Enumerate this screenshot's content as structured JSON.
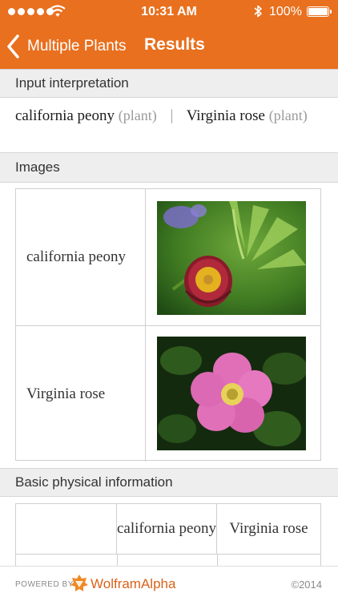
{
  "status_bar": {
    "time": "10:31 AM",
    "battery_percent": "100%",
    "battery_level": 1.0,
    "icons": [
      "signal-dots-icon",
      "wifi-icon",
      "bluetooth-icon",
      "battery-icon"
    ]
  },
  "nav": {
    "back_label": "Multiple Plants",
    "title": "Results",
    "back_icon": "chevron-left-icon"
  },
  "colors": {
    "accent": "#e8701f",
    "header_bg": "#eeeeee",
    "brand_text": "#d8621a"
  },
  "input_interpretation": {
    "header": "Input interpretation",
    "items": [
      {
        "name": "california peony",
        "annotation": "(plant)"
      },
      {
        "name": "Virginia rose",
        "annotation": "(plant)"
      }
    ],
    "separator": "|"
  },
  "images": {
    "header": "Images",
    "rows": [
      {
        "label": "california peony",
        "image": "california-peony-photo"
      },
      {
        "label": "Virginia rose",
        "image": "virginia-rose-photo"
      }
    ]
  },
  "basic_physical": {
    "header": "Basic physical information",
    "columns": [
      "",
      "california peony",
      "Virginia rose"
    ]
  },
  "footer": {
    "powered_by": "POWERED BY",
    "brand": "WolframAlpha",
    "copyright": "©2014",
    "logo_icon": "wolframalpha-logo-icon"
  }
}
